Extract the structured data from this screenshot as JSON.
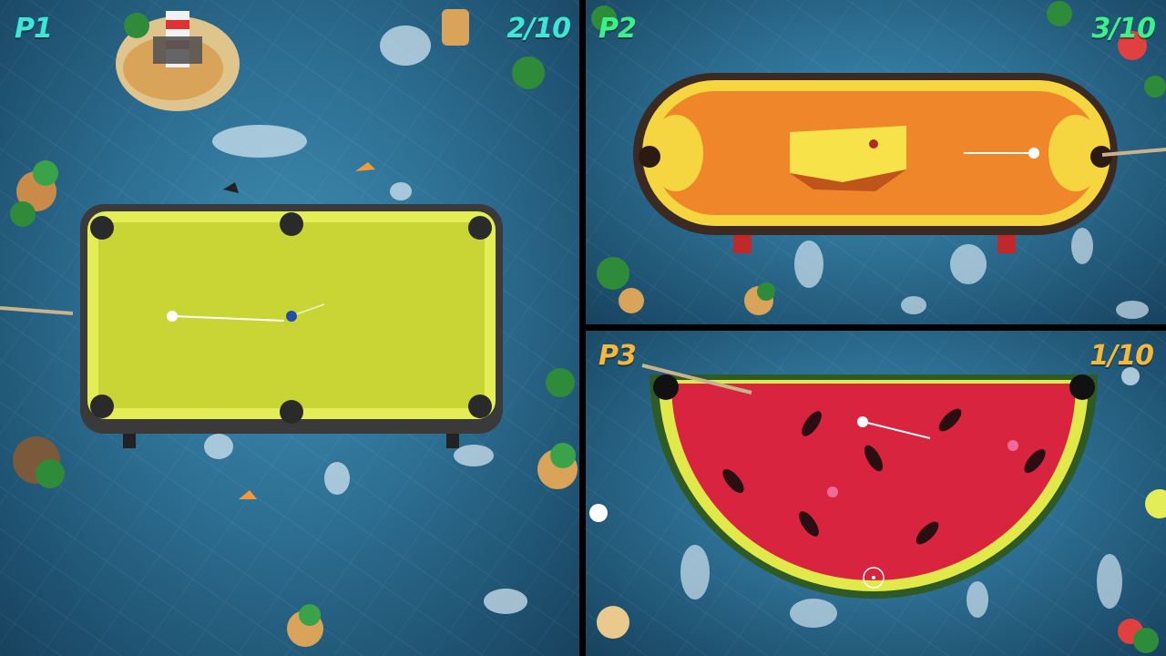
{
  "players": [
    {
      "id": "p1",
      "label": "P1",
      "score": "2/10",
      "color": "#3ee6d8"
    },
    {
      "id": "p2",
      "label": "P2",
      "score": "3/10",
      "color": "#3cf08a"
    },
    {
      "id": "p3",
      "label": "P3",
      "score": "1/10",
      "color": "#f4b93a"
    }
  ],
  "tables": {
    "p1": {
      "theme": "classic",
      "felt": "#d9e64a",
      "rail": "#3a3a3a"
    },
    "p2": {
      "theme": "orange-stadium",
      "felt": "#f0862a",
      "rail": "#f6d640"
    },
    "p3": {
      "theme": "watermelon",
      "felt": "#d8243f",
      "rind": "#e0e84a"
    }
  }
}
